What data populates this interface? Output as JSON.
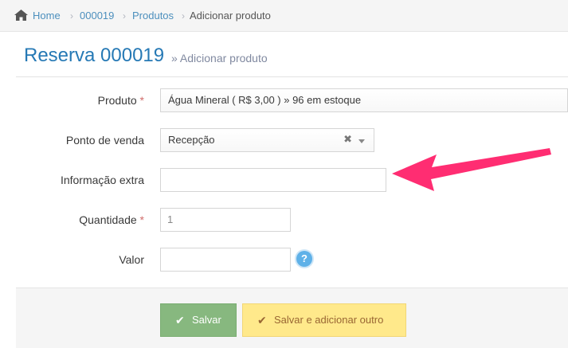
{
  "breadcrumb": {
    "home": "Home",
    "reservation": "000019",
    "products": "Produtos",
    "current": "Adicionar produto",
    "separator": "›"
  },
  "page": {
    "title": "Reserva 000019",
    "subtitle": "» Adicionar produto"
  },
  "form": {
    "produto": {
      "label": "Produto",
      "required_mark": "*",
      "value": "Água Mineral ( R$ 3,00 ) » 96 em estoque"
    },
    "ponto_venda": {
      "label": "Ponto de venda",
      "value": "Recepção",
      "clear": "✖"
    },
    "info_extra": {
      "label": "Informação extra",
      "value": ""
    },
    "quantidade": {
      "label": "Quantidade",
      "required_mark": "*",
      "value": "1"
    },
    "valor": {
      "label": "Valor",
      "value": "",
      "help": "?"
    }
  },
  "actions": {
    "save": "Salvar",
    "save_add": "Salvar e adicionar outro",
    "check": "✔"
  },
  "colors": {
    "title": "#2679b5",
    "link": "#4c8fbd",
    "save_button": "#87b87f",
    "save_add_button": "#ffe98b",
    "annotation_arrow": "#ff2d72",
    "help_icon": "#5fb1e8"
  },
  "icons": [
    "home-icon",
    "question-icon",
    "check-icon",
    "clear-icon",
    "chevron-down-icon",
    "annotation-arrow"
  ]
}
